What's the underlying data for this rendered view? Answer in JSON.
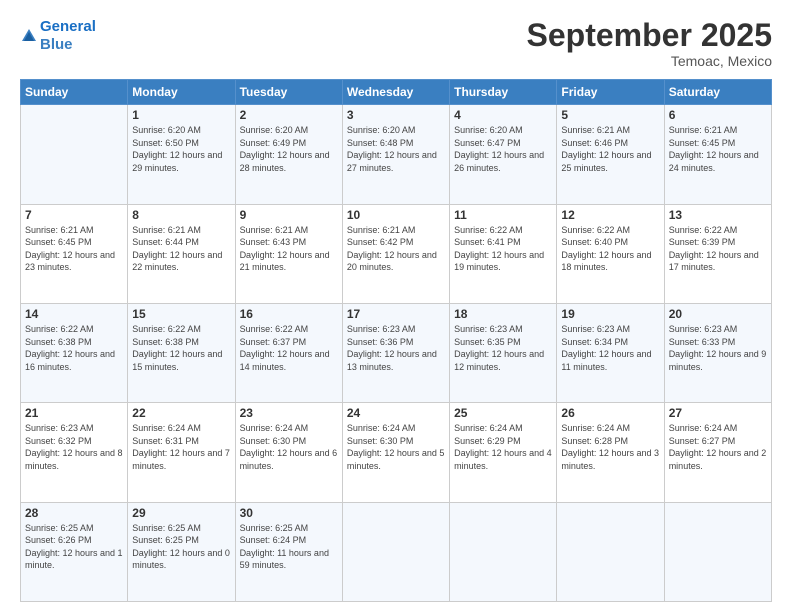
{
  "logo": {
    "line1": "General",
    "line2": "Blue"
  },
  "title": "September 2025",
  "location": "Temoac, Mexico",
  "days": [
    "Sunday",
    "Monday",
    "Tuesday",
    "Wednesday",
    "Thursday",
    "Friday",
    "Saturday"
  ],
  "weeks": [
    [
      {
        "num": "",
        "sunrise": "",
        "sunset": "",
        "daylight": ""
      },
      {
        "num": "1",
        "sunrise": "Sunrise: 6:20 AM",
        "sunset": "Sunset: 6:50 PM",
        "daylight": "Daylight: 12 hours and 29 minutes."
      },
      {
        "num": "2",
        "sunrise": "Sunrise: 6:20 AM",
        "sunset": "Sunset: 6:49 PM",
        "daylight": "Daylight: 12 hours and 28 minutes."
      },
      {
        "num": "3",
        "sunrise": "Sunrise: 6:20 AM",
        "sunset": "Sunset: 6:48 PM",
        "daylight": "Daylight: 12 hours and 27 minutes."
      },
      {
        "num": "4",
        "sunrise": "Sunrise: 6:20 AM",
        "sunset": "Sunset: 6:47 PM",
        "daylight": "Daylight: 12 hours and 26 minutes."
      },
      {
        "num": "5",
        "sunrise": "Sunrise: 6:21 AM",
        "sunset": "Sunset: 6:46 PM",
        "daylight": "Daylight: 12 hours and 25 minutes."
      },
      {
        "num": "6",
        "sunrise": "Sunrise: 6:21 AM",
        "sunset": "Sunset: 6:45 PM",
        "daylight": "Daylight: 12 hours and 24 minutes."
      }
    ],
    [
      {
        "num": "7",
        "sunrise": "Sunrise: 6:21 AM",
        "sunset": "Sunset: 6:45 PM",
        "daylight": "Daylight: 12 hours and 23 minutes."
      },
      {
        "num": "8",
        "sunrise": "Sunrise: 6:21 AM",
        "sunset": "Sunset: 6:44 PM",
        "daylight": "Daylight: 12 hours and 22 minutes."
      },
      {
        "num": "9",
        "sunrise": "Sunrise: 6:21 AM",
        "sunset": "Sunset: 6:43 PM",
        "daylight": "Daylight: 12 hours and 21 minutes."
      },
      {
        "num": "10",
        "sunrise": "Sunrise: 6:21 AM",
        "sunset": "Sunset: 6:42 PM",
        "daylight": "Daylight: 12 hours and 20 minutes."
      },
      {
        "num": "11",
        "sunrise": "Sunrise: 6:22 AM",
        "sunset": "Sunset: 6:41 PM",
        "daylight": "Daylight: 12 hours and 19 minutes."
      },
      {
        "num": "12",
        "sunrise": "Sunrise: 6:22 AM",
        "sunset": "Sunset: 6:40 PM",
        "daylight": "Daylight: 12 hours and 18 minutes."
      },
      {
        "num": "13",
        "sunrise": "Sunrise: 6:22 AM",
        "sunset": "Sunset: 6:39 PM",
        "daylight": "Daylight: 12 hours and 17 minutes."
      }
    ],
    [
      {
        "num": "14",
        "sunrise": "Sunrise: 6:22 AM",
        "sunset": "Sunset: 6:38 PM",
        "daylight": "Daylight: 12 hours and 16 minutes."
      },
      {
        "num": "15",
        "sunrise": "Sunrise: 6:22 AM",
        "sunset": "Sunset: 6:38 PM",
        "daylight": "Daylight: 12 hours and 15 minutes."
      },
      {
        "num": "16",
        "sunrise": "Sunrise: 6:22 AM",
        "sunset": "Sunset: 6:37 PM",
        "daylight": "Daylight: 12 hours and 14 minutes."
      },
      {
        "num": "17",
        "sunrise": "Sunrise: 6:23 AM",
        "sunset": "Sunset: 6:36 PM",
        "daylight": "Daylight: 12 hours and 13 minutes."
      },
      {
        "num": "18",
        "sunrise": "Sunrise: 6:23 AM",
        "sunset": "Sunset: 6:35 PM",
        "daylight": "Daylight: 12 hours and 12 minutes."
      },
      {
        "num": "19",
        "sunrise": "Sunrise: 6:23 AM",
        "sunset": "Sunset: 6:34 PM",
        "daylight": "Daylight: 12 hours and 11 minutes."
      },
      {
        "num": "20",
        "sunrise": "Sunrise: 6:23 AM",
        "sunset": "Sunset: 6:33 PM",
        "daylight": "Daylight: 12 hours and 9 minutes."
      }
    ],
    [
      {
        "num": "21",
        "sunrise": "Sunrise: 6:23 AM",
        "sunset": "Sunset: 6:32 PM",
        "daylight": "Daylight: 12 hours and 8 minutes."
      },
      {
        "num": "22",
        "sunrise": "Sunrise: 6:24 AM",
        "sunset": "Sunset: 6:31 PM",
        "daylight": "Daylight: 12 hours and 7 minutes."
      },
      {
        "num": "23",
        "sunrise": "Sunrise: 6:24 AM",
        "sunset": "Sunset: 6:30 PM",
        "daylight": "Daylight: 12 hours and 6 minutes."
      },
      {
        "num": "24",
        "sunrise": "Sunrise: 6:24 AM",
        "sunset": "Sunset: 6:30 PM",
        "daylight": "Daylight: 12 hours and 5 minutes."
      },
      {
        "num": "25",
        "sunrise": "Sunrise: 6:24 AM",
        "sunset": "Sunset: 6:29 PM",
        "daylight": "Daylight: 12 hours and 4 minutes."
      },
      {
        "num": "26",
        "sunrise": "Sunrise: 6:24 AM",
        "sunset": "Sunset: 6:28 PM",
        "daylight": "Daylight: 12 hours and 3 minutes."
      },
      {
        "num": "27",
        "sunrise": "Sunrise: 6:24 AM",
        "sunset": "Sunset: 6:27 PM",
        "daylight": "Daylight: 12 hours and 2 minutes."
      }
    ],
    [
      {
        "num": "28",
        "sunrise": "Sunrise: 6:25 AM",
        "sunset": "Sunset: 6:26 PM",
        "daylight": "Daylight: 12 hours and 1 minute."
      },
      {
        "num": "29",
        "sunrise": "Sunrise: 6:25 AM",
        "sunset": "Sunset: 6:25 PM",
        "daylight": "Daylight: 12 hours and 0 minutes."
      },
      {
        "num": "30",
        "sunrise": "Sunrise: 6:25 AM",
        "sunset": "Sunset: 6:24 PM",
        "daylight": "Daylight: 11 hours and 59 minutes."
      },
      {
        "num": "",
        "sunrise": "",
        "sunset": "",
        "daylight": ""
      },
      {
        "num": "",
        "sunrise": "",
        "sunset": "",
        "daylight": ""
      },
      {
        "num": "",
        "sunrise": "",
        "sunset": "",
        "daylight": ""
      },
      {
        "num": "",
        "sunrise": "",
        "sunset": "",
        "daylight": ""
      }
    ]
  ]
}
